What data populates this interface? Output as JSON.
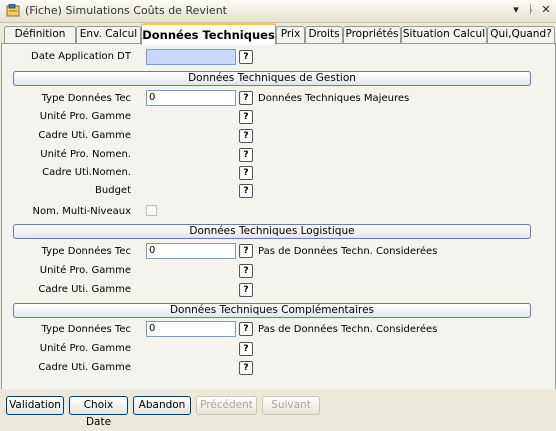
{
  "window": {
    "title": "(Fiche) Simulations Coûts de Revient",
    "controls": [
      "▾",
      "ᚿ",
      "✕"
    ]
  },
  "tabs": [
    {
      "label": "Définition"
    },
    {
      "label": "Env. Calcul"
    },
    {
      "label": "Données Techniques",
      "active": true
    },
    {
      "label": "Prix"
    },
    {
      "label": "Droits"
    },
    {
      "label": "Propriétés"
    },
    {
      "label": "Situation Calcul"
    },
    {
      "label": "Qui,Quand?"
    }
  ],
  "form": {
    "date_application": {
      "label": "Date Application DT",
      "value": ""
    },
    "help": "?",
    "gestion": {
      "header": "Données Techniques de Gestion",
      "type_label": "Type Données Tec",
      "type_value": "0",
      "type_desc": "Données Techniques Majeures",
      "unite_gamme": "Unité Pro. Gamme",
      "cadre_gamme": "Cadre Uti. Gamme",
      "unite_nomen": "Unité Pro. Nomen.",
      "cadre_nomen": "Cadre Uti.Nomen.",
      "budget": "Budget",
      "multi_niveaux": "Nom. Multi-Niveaux"
    },
    "logistique": {
      "header": "Données Techniques Logistique",
      "type_label": "Type Données Tec",
      "type_value": "0",
      "type_desc": "Pas de Données Techn. Considerées",
      "unite_gamme": "Unité Pro. Gamme",
      "cadre_gamme": "Cadre Uti. Gamme"
    },
    "complementaires": {
      "header": "Données Techniques Complémentaires",
      "type_label": "Type Données Tec",
      "type_value": "0",
      "type_desc": "Pas de Données Techn. Considerées",
      "unite_gamme": "Unité Pro. Gamme",
      "cadre_gamme": "Cadre Uti. Gamme"
    }
  },
  "buttons": {
    "validation": "Validation",
    "choix_date": "Choix Date",
    "abandon": "Abandon",
    "precedent": "Précédent",
    "suivant": "Suivant"
  }
}
